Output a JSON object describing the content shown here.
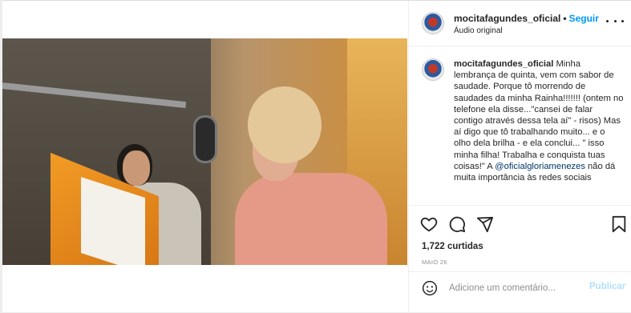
{
  "header": {
    "username": "mocitafagundes_oficial",
    "separator": "•",
    "follow_label": "Seguir",
    "audio_label": "Áudio original"
  },
  "caption": {
    "username": "mocitafagundes_oficial",
    "text_1": " Minha lembrança de quinta, vem com sabor de saudade. Porque tô morrendo de saudades da minha Rainha!!!!!!! (ontem no telefone ela disse...\"cansei de falar contigo através dessa tela aí\" - risos) Mas aí digo que tô trabalhando muito... e o olho dela brilha - e ela conclui... \" isso minha filha! Trabalha e conquista tuas coisas!\" A ",
    "mention": "@oficialgloriamenezes",
    "text_2": " não dá muita importância às redes sociais"
  },
  "likes": "1,722 curtidas",
  "date": "MAIO 26",
  "comment": {
    "placeholder": "Adicione um comentário...",
    "publish_label": "Publicar"
  },
  "icons": [
    "more-options-icon",
    "heart-icon",
    "comment-icon",
    "share-icon",
    "bookmark-icon",
    "emoji-icon",
    "muted-speaker-icon"
  ],
  "colors": {
    "accent": "#0095f6",
    "publish_disabled": "#b2dffc",
    "text": "#262626",
    "muted": "#8e8e8e"
  }
}
